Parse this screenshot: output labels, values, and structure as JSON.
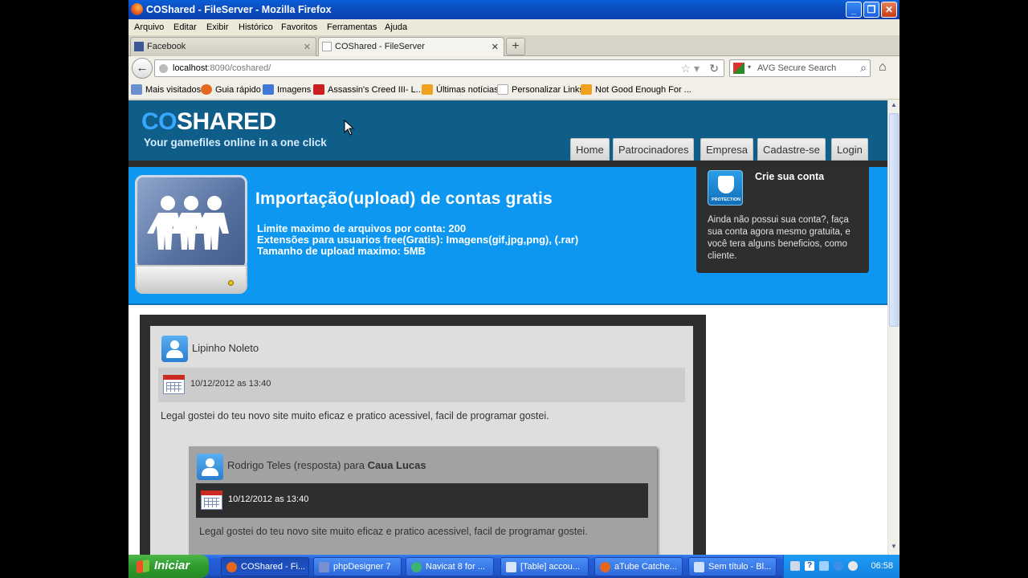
{
  "window": {
    "title": "COShared - FileServer - Mozilla Firefox"
  },
  "menu": [
    "Arquivo",
    "Editar",
    "Exibir",
    "Histórico",
    "Favoritos",
    "Ferramentas",
    "Ajuda"
  ],
  "tabs": [
    {
      "label": "Facebook",
      "active": false
    },
    {
      "label": "COShared - FileServer",
      "active": true
    }
  ],
  "address": {
    "host": "localhost",
    "rest": ":8090/coshared/"
  },
  "search": {
    "placeholder": "AVG Secure Search"
  },
  "bookmarks": [
    "Mais visitados",
    "Guia rápido",
    "Imagens",
    "Assassin's Creed III- L...",
    "Últimas notícias",
    "Personalizar Links",
    "Not Good Enough For ..."
  ],
  "site": {
    "logo_co": "CO",
    "logo_rest": "SHARED",
    "tagline": "Your gamefiles online in a one click",
    "nav": [
      "Home",
      "Patrocinadores",
      "Empresa",
      "Cadastre-se",
      "Login"
    ]
  },
  "hero": {
    "title": "Importação(upload) de contas gratis",
    "lines": [
      "Limite maximo de arquivos por conta: 200",
      "Extensões para usuarios free(Gratis): Imagens(gif,jpg,png), (.rar)",
      "Tamanho de upload maximo: 5MB"
    ]
  },
  "signup": {
    "badge_text": "PROTECTION",
    "title": "Crie sua conta",
    "text": "Ainda não possui sua conta?, faça sua conta agora mesmo gratuita, e você tera alguns beneficios, como cliente."
  },
  "comments": [
    {
      "author": "Lipinho Noleto",
      "date": "10/12/2012 as 13:40",
      "text": "Legal gostei do teu novo site muito eficaz e pratico acessivel, facil de programar gostei."
    }
  ],
  "reply": {
    "author": "Rodrigo Teles",
    "mid": " (resposta) para ",
    "to": "Caua Lucas",
    "date": "10/12/2012 as 13:40",
    "text": "Legal gostei do teu novo site muito eficaz e pratico acessivel, facil de programar gostei."
  },
  "taskbar": {
    "start": "Iniciar",
    "items": [
      "COShared - Fi...",
      "phpDesigner 7",
      "Navicat 8 for ...",
      "[Table] accou...",
      "aTube Catche...",
      "Sem título - Bl..."
    ],
    "clock": "06:58"
  }
}
